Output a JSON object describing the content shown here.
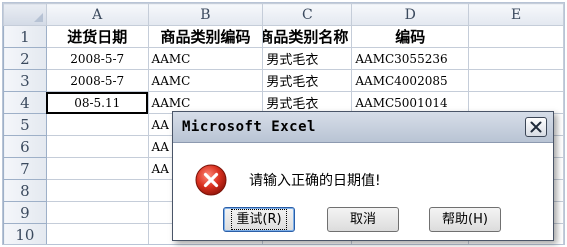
{
  "grid": {
    "columns": [
      "A",
      "B",
      "C",
      "D",
      "E"
    ],
    "rows": [
      "1",
      "2",
      "3",
      "4",
      "5",
      "6",
      "7",
      "8",
      "9",
      "10"
    ],
    "header_row": [
      "进货日期",
      "商品类别编码",
      "商品类别名称",
      "编码",
      ""
    ],
    "data": [
      [
        "2008-5-7",
        "AAMC",
        "男式毛衣",
        "AAMC3055236",
        ""
      ],
      [
        "2008-5-7",
        "AAMC",
        "男式毛衣",
        "AAMC4002085",
        ""
      ],
      [
        "08-5.11",
        "AAMC",
        "男式毛衣",
        "AAMC5001014",
        ""
      ],
      [
        "",
        "AA",
        "",
        "",
        ""
      ],
      [
        "",
        "AA",
        "",
        "",
        ""
      ],
      [
        "",
        "AA",
        "",
        "",
        ""
      ]
    ]
  },
  "dialog": {
    "title": "Microsoft Excel",
    "message": "请输入正确的日期值!",
    "retry_label": "重试(R)",
    "cancel_label": "取消",
    "help_label": "帮助(H)"
  },
  "icons": {
    "error": "error-x-icon",
    "close": "close-icon"
  },
  "colors": {
    "error_red": "#c4271b",
    "dialog_border": "#4a5568"
  }
}
